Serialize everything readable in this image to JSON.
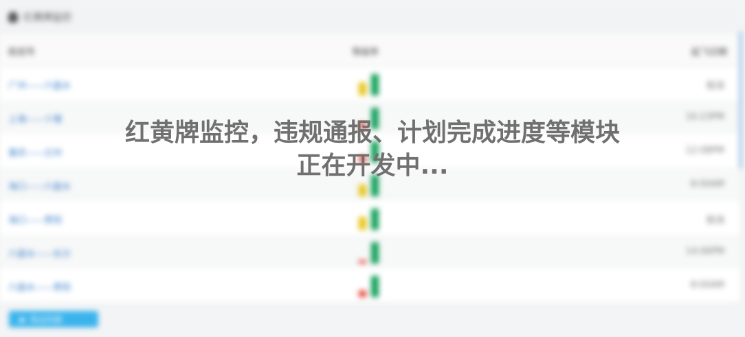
{
  "header": {
    "title": "红黄牌监控"
  },
  "table": {
    "columns": [
      "航班号",
      "等级率",
      "起飞日期"
    ],
    "rows": [
      {
        "route": "广州——六盘水",
        "time": "取消",
        "yellow": 0.55,
        "red": 0,
        "green": 0.9
      },
      {
        "route": "上海——十堰",
        "time": "16:23PM",
        "yellow": 0,
        "red": 0.25,
        "green": 0.9
      },
      {
        "route": "重庆——兰州",
        "time": "12:08PM",
        "yellow": 0,
        "red": 0.3,
        "green": 0.9
      },
      {
        "route": "海口——六盘水",
        "time": "8:00AM",
        "yellow": 0.5,
        "red": 0,
        "green": 0.9
      },
      {
        "route": "海口——贵阳",
        "time": "取消",
        "yellow": 0.55,
        "red": 0,
        "green": 0.9
      },
      {
        "route": "六盘水——长沙",
        "time": "14:06PM",
        "yellow": 0,
        "red": 0.15,
        "green": 0.9
      },
      {
        "route": "六盘水——贵阳",
        "time": "8:00AM",
        "yellow": 0,
        "red": 0.3,
        "green": 0.9
      }
    ]
  },
  "export_button": {
    "label": "导出列表"
  },
  "overlay": {
    "line1": "红黄牌监控，违规通报、计划完成进度等模块",
    "line2": "正在开发中..."
  },
  "colors": {
    "link": "#3b7fc9",
    "yellow": "#e8c61a",
    "red": "#e84c3d",
    "green": "#12a05a",
    "button": "#3ab3ec"
  }
}
